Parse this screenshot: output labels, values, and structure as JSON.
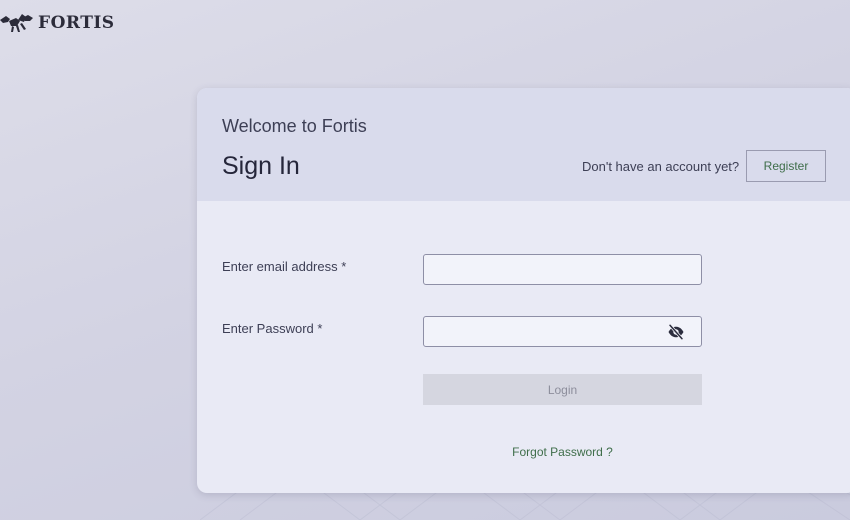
{
  "brand": {
    "name": "FORTIS",
    "logo_icon": "winged-horse-logo-icon"
  },
  "header": {
    "welcome": "Welcome to Fortis",
    "title": "Sign In",
    "no_account_text": "Don't have an account yet?",
    "register_label": "Register"
  },
  "form": {
    "email_label": "Enter email address *",
    "email_value": "",
    "password_label": "Enter Password *",
    "password_value": "",
    "password_toggle_icon": "eye-off-icon",
    "login_label": "Login",
    "forgot_label": "Forgot Password ?"
  },
  "colors": {
    "accent_green": "#3f6e4a",
    "header_bg": "#d9dbec",
    "card_bg": "#e9eaf5",
    "disabled_button": "#d5d6e0"
  }
}
